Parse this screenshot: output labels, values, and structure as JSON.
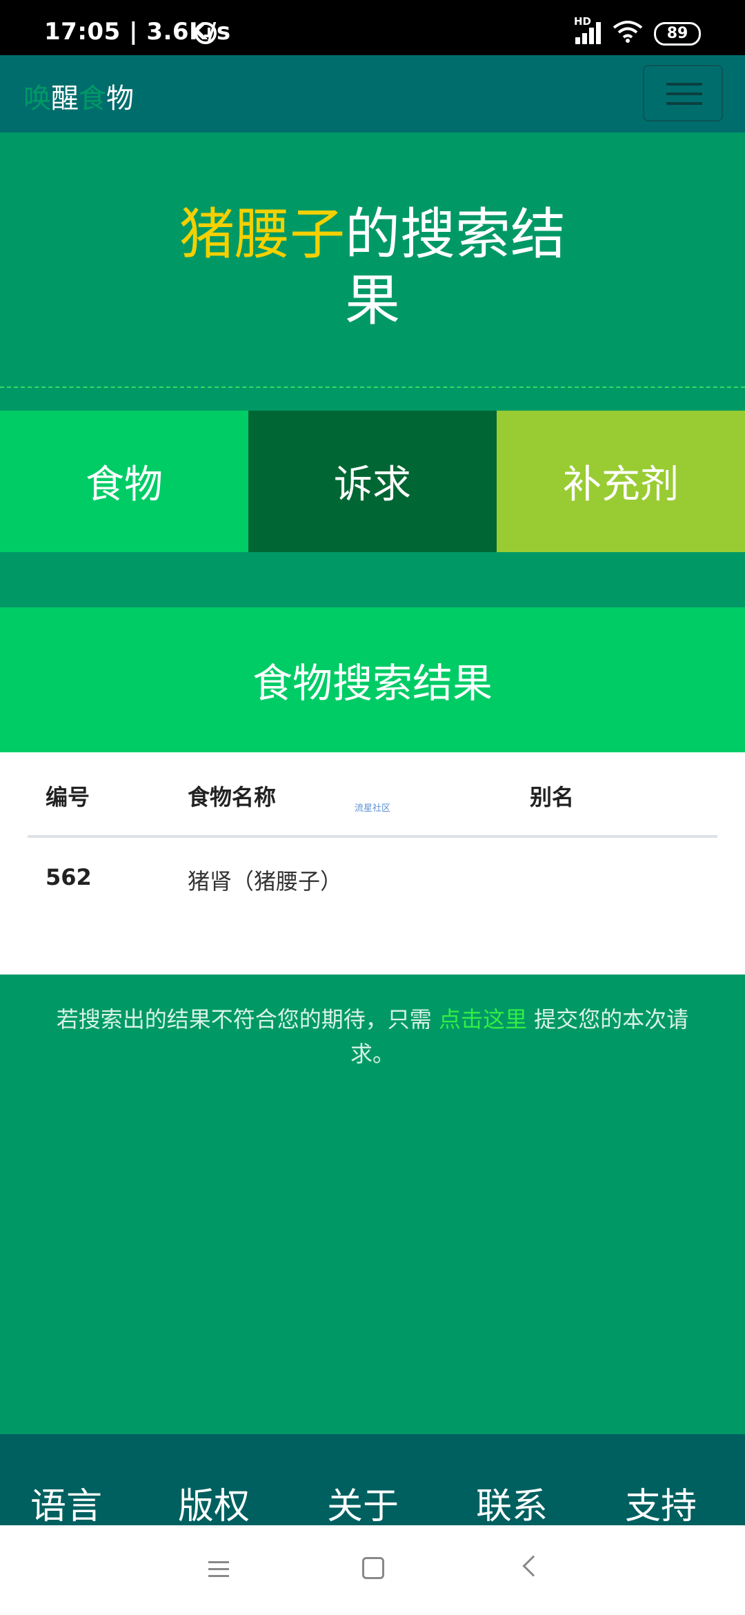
{
  "status_bar": {
    "time_speed": "17:05 | 3.6K/s",
    "network_label": "HD",
    "battery": "89"
  },
  "navbar": {
    "brand_part1": "唤",
    "brand_part2": "醒",
    "brand_part3": "食",
    "brand_part4": "物"
  },
  "hero": {
    "keyword": "猪腰子",
    "title_rest_line1": "的搜索结",
    "title_rest_line2": "果"
  },
  "tabs": [
    {
      "label": "食物"
    },
    {
      "label": "诉求"
    },
    {
      "label": "补充剂"
    }
  ],
  "results": {
    "heading": "食物搜索结果",
    "columns": [
      "编号",
      "食物名称",
      "别名"
    ],
    "watermark": "流星社区",
    "rows": [
      {
        "id": "562",
        "name": "猪肾（猪腰子）",
        "alias": ""
      }
    ]
  },
  "note": {
    "before": "若搜索出的结果不符合您的期待，只需 ",
    "link": "点击这里",
    "after": " 提交您的本次请求。"
  },
  "bottom_nav": [
    "语言",
    "版权",
    "关于",
    "联系",
    "支持"
  ],
  "colors": {
    "primary": "#009966",
    "navbar": "#006d6d",
    "accent_yellow": "#f5d000",
    "tab_food": "#00cc66",
    "tab_need": "#006633",
    "tab_supp": "#99cc33",
    "link": "#33ee44"
  }
}
